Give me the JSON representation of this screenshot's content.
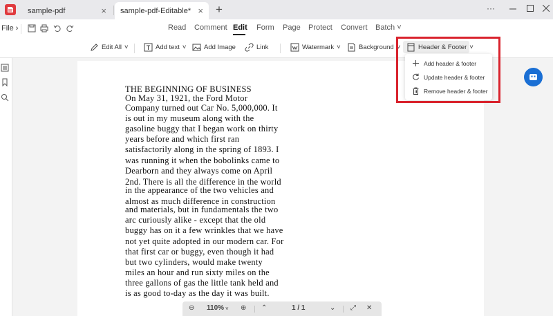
{
  "tabs": [
    {
      "label": "sample-pdf",
      "active": false
    },
    {
      "label": "sample-pdf-Editable*",
      "active": true
    }
  ],
  "window": {
    "more_label": "···"
  },
  "menubar": {
    "file_label": "File",
    "items": [
      "Read",
      "Comment",
      "Edit",
      "Form",
      "Page",
      "Protect",
      "Convert",
      "Batch"
    ],
    "active_item": "Edit"
  },
  "toolbar": {
    "edit_all": "Edit All",
    "add_text": "Add text",
    "add_image": "Add Image",
    "link": "Link",
    "watermark": "Watermark",
    "background": "Background",
    "header_footer": "Header & Footer"
  },
  "header_footer_menu": {
    "items": [
      {
        "label": "Add header & footer",
        "icon": "plus-icon"
      },
      {
        "label": "Update header & footer",
        "icon": "refresh-icon"
      },
      {
        "label": "Remove header & footer",
        "icon": "trash-icon"
      }
    ]
  },
  "document": {
    "lines": [
      "THE BEGINNING OF BUSINESS",
      "On May 31, 1921, the Ford Motor",
      "Company turned out Car No. 5,000,000. It",
      "is out in my museum along with the",
      "gasoline buggy that I began work on thirty",
      "years before and which first ran",
      "satisfactorily along in the spring of 1893. I",
      "was running it when the bobolinks came to",
      "Dearborn and they always come on April",
      "2nd. There is all the difference in the world",
      "in the appearance of the two vehicles and",
      "almost as much difference in construction",
      "and materials, but in fundamentals the two",
      "arc curiously alike - except that the old",
      "buggy has on it a few wrinkles that we have",
      "not yet quite adopted in our modern car. For",
      "that first car or buggy, even though it had",
      "but two cylinders, would make twenty",
      "miles an hour and run sixty miles on the",
      "three gallons of gas the little tank held and",
      "is as good to-day as the day it was built."
    ]
  },
  "zoom": {
    "level": "110%",
    "page_indicator": "1 / 1"
  },
  "colors": {
    "highlight_border": "#d9232d",
    "accent_blue": "#1a6fd4",
    "brand_red": "#e03a3e"
  }
}
